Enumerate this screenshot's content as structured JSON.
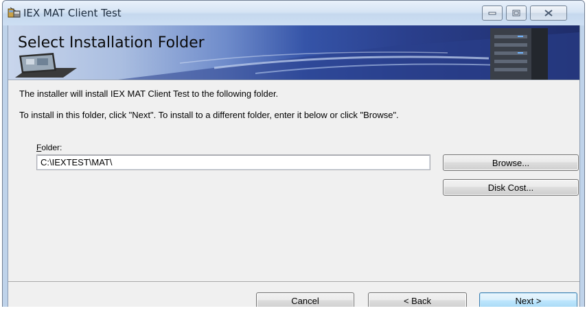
{
  "window": {
    "title": "IEX MAT Client Test",
    "icon": "installer-icon"
  },
  "banner": {
    "title": "Select Installation Folder"
  },
  "body": {
    "line1": "The installer will install IEX MAT Client Test to the following folder.",
    "line2": "To install in this folder, click \"Next\". To install to a different folder, enter it below or click \"Browse\"."
  },
  "folder": {
    "label_accel": "F",
    "label_rest": "older:",
    "value": "C:\\IEXTEST\\MAT\\"
  },
  "buttons": {
    "browse": "Browse...",
    "disk_cost": "Disk Cost...",
    "cancel": "Cancel",
    "back": "< Back",
    "next": "Next >"
  },
  "colors": {
    "banner_dark": "#1f2d6a",
    "default_button_border": "#3c7fb1"
  }
}
